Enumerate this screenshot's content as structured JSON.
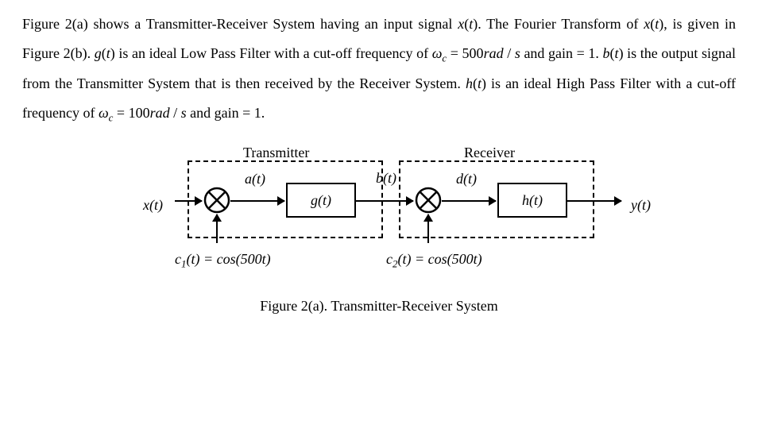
{
  "paragraph": {
    "s1a": "Figure 2(a) shows a Transmitter-Receiver System having an input signal ",
    "xt": "x",
    "lp": "(",
    "tvar": "t",
    "rp": ")",
    "s1b": ". The Fourier Transform of ",
    "s1c": ", is given in Figure 2(b).",
    "space": " ",
    "gt": "g",
    "s2": " is an ideal Low Pass Filter with a cut-off frequency of ",
    "omega": "ω",
    "csub": "c",
    "eq1": " = 500",
    "rad": "rad",
    "perS": " / ",
    "svar": "s",
    "gain1": " and gain = 1. ",
    "bt": "b",
    "s3": " is the output signal from the Transmitter System that is then received by the Receiver System. ",
    "ht": "h",
    "s4": " is an ideal High Pass Filter with a cut-off frequency of ",
    "eq2": " = 100",
    "gain2": " and gain = 1."
  },
  "labels": {
    "transmitter": "Transmitter",
    "receiver": "Receiver",
    "xt_full": "x(t)",
    "at_full": "a(t)",
    "bt_full": "b(t)",
    "dt_full": "d(t)",
    "yt_full": "y(t)",
    "gt_full": "g(t)",
    "ht_full": "h(t)"
  },
  "carriers": {
    "c1_name": "c",
    "c1_sub": "1",
    "c1_rest": "(t) = cos(500t)",
    "c2_name": "c",
    "c2_sub": "2",
    "c2_rest": "(t) = cos(500t)"
  },
  "caption": "Figure 2(a). Transmitter-Receiver System"
}
